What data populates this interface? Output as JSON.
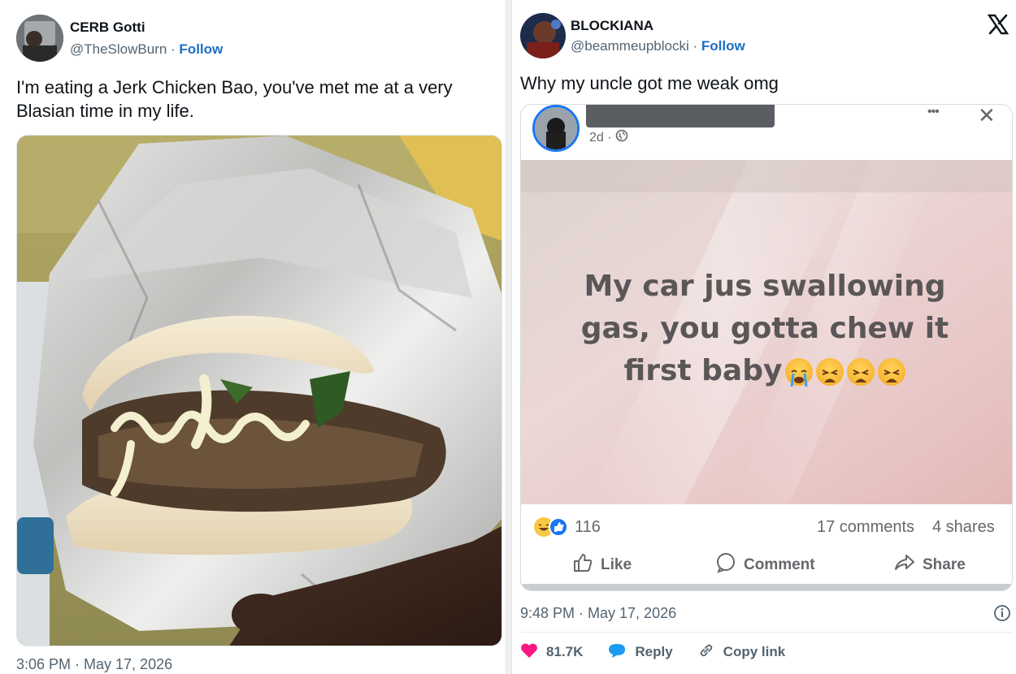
{
  "left_tweet": {
    "author_name": "CERB Gotti",
    "handle": "@TheSlowBurn",
    "separator": " · ",
    "follow_label": "Follow",
    "text_line1": "I'm eating a Jerk Chicken Bao, you've met me at a very",
    "text_line2": "Blasian time in my life.",
    "timestamp": "3:06 PM · May 17, 2026"
  },
  "right_tweet": {
    "author_name": "BLOCKIANA",
    "handle": "@beammeupblocki",
    "separator": " · ",
    "follow_label": "Follow",
    "text": "Why my uncle got me weak omg",
    "timestamp": "9:48 PM · May 17, 2026",
    "likes": "81.7K",
    "reply_label": "Reply",
    "copy_link_label": "Copy link",
    "platform_icon": "x-logo-icon"
  },
  "facebook_embed": {
    "post_age": "2d ·",
    "more_icon": "•••",
    "close_icon": "✕",
    "post_text_line1": "My car jus swallowing",
    "post_text_line2": "gas, you gotta chew it",
    "post_text_line3": "first baby",
    "reaction_count": "116",
    "comments": "17 comments",
    "shares": "4 shares",
    "like_label": "Like",
    "comment_label": "Comment",
    "share_label": "Share"
  },
  "colors": {
    "follow_blue": "#1d6fc4",
    "like_pink": "#f91880",
    "reply_blue": "#1d9bf0",
    "fb_blue": "#1877f2"
  }
}
